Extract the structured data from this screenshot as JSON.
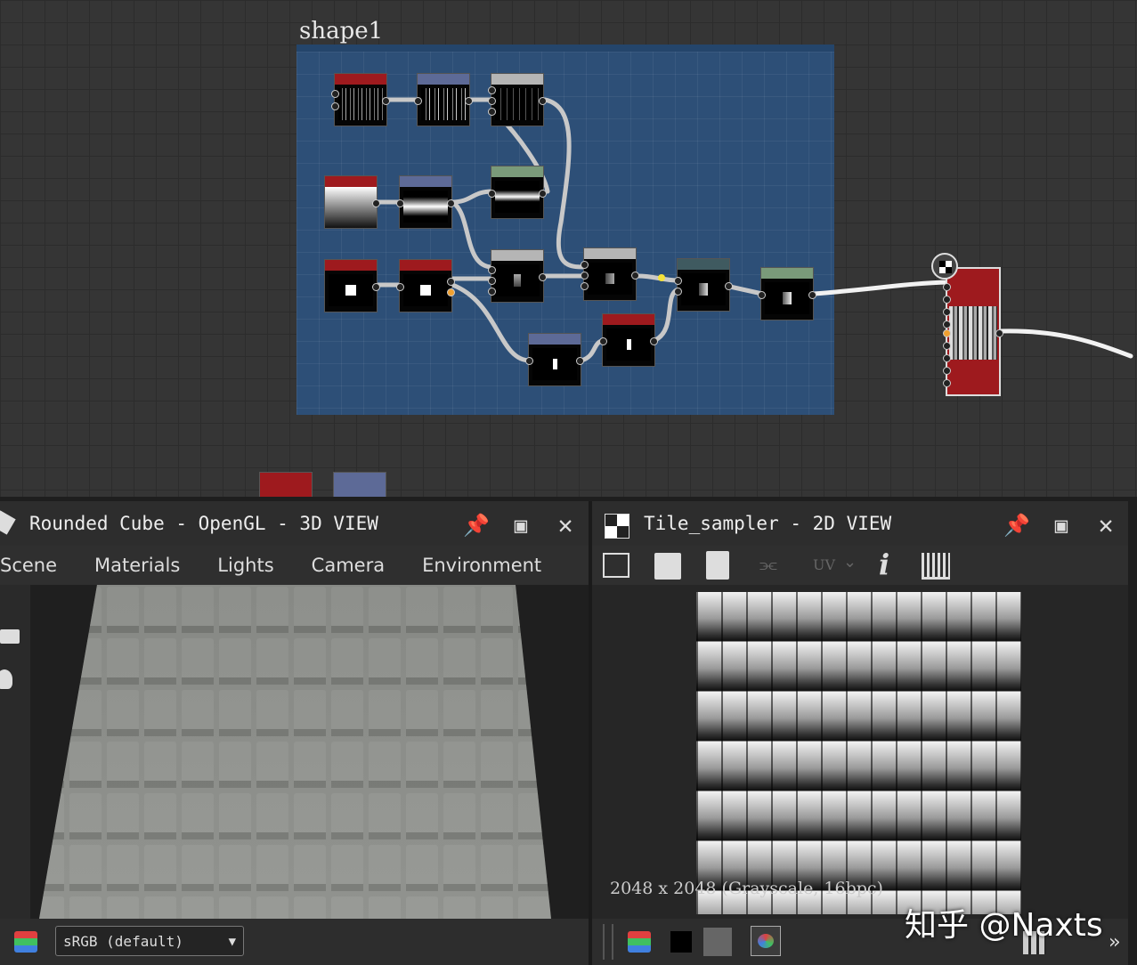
{
  "graph": {
    "frame_title": "shape1"
  },
  "view3d": {
    "title": "Rounded Cube - OpenGL - 3D VIEW",
    "menu": [
      "Scene",
      "Materials",
      "Lights",
      "Camera",
      "Environment"
    ],
    "colorspace": "sRGB (default)"
  },
  "view2d": {
    "title": "Tile_sampler - 2D VIEW",
    "uv_label": "UV",
    "image_info": "2048 x 2048 (Grayscale, 16bpc)"
  },
  "watermark": "知乎 @Naxts",
  "colors": {
    "frame_bg": "#2d4f77",
    "node_red": "#9e1a1e",
    "node_blue": "#5d6a97",
    "node_grey": "#b5b5b5",
    "node_green": "#7a9a7a",
    "node_teal": "#3f5a60"
  },
  "icons": [
    "pin-icon",
    "maximize-icon",
    "close-icon",
    "cube-icon",
    "checker-icon",
    "camera-icon",
    "light-icon",
    "save-icon",
    "copy-icon",
    "info-icon",
    "histogram-icon",
    "layers-icon"
  ]
}
